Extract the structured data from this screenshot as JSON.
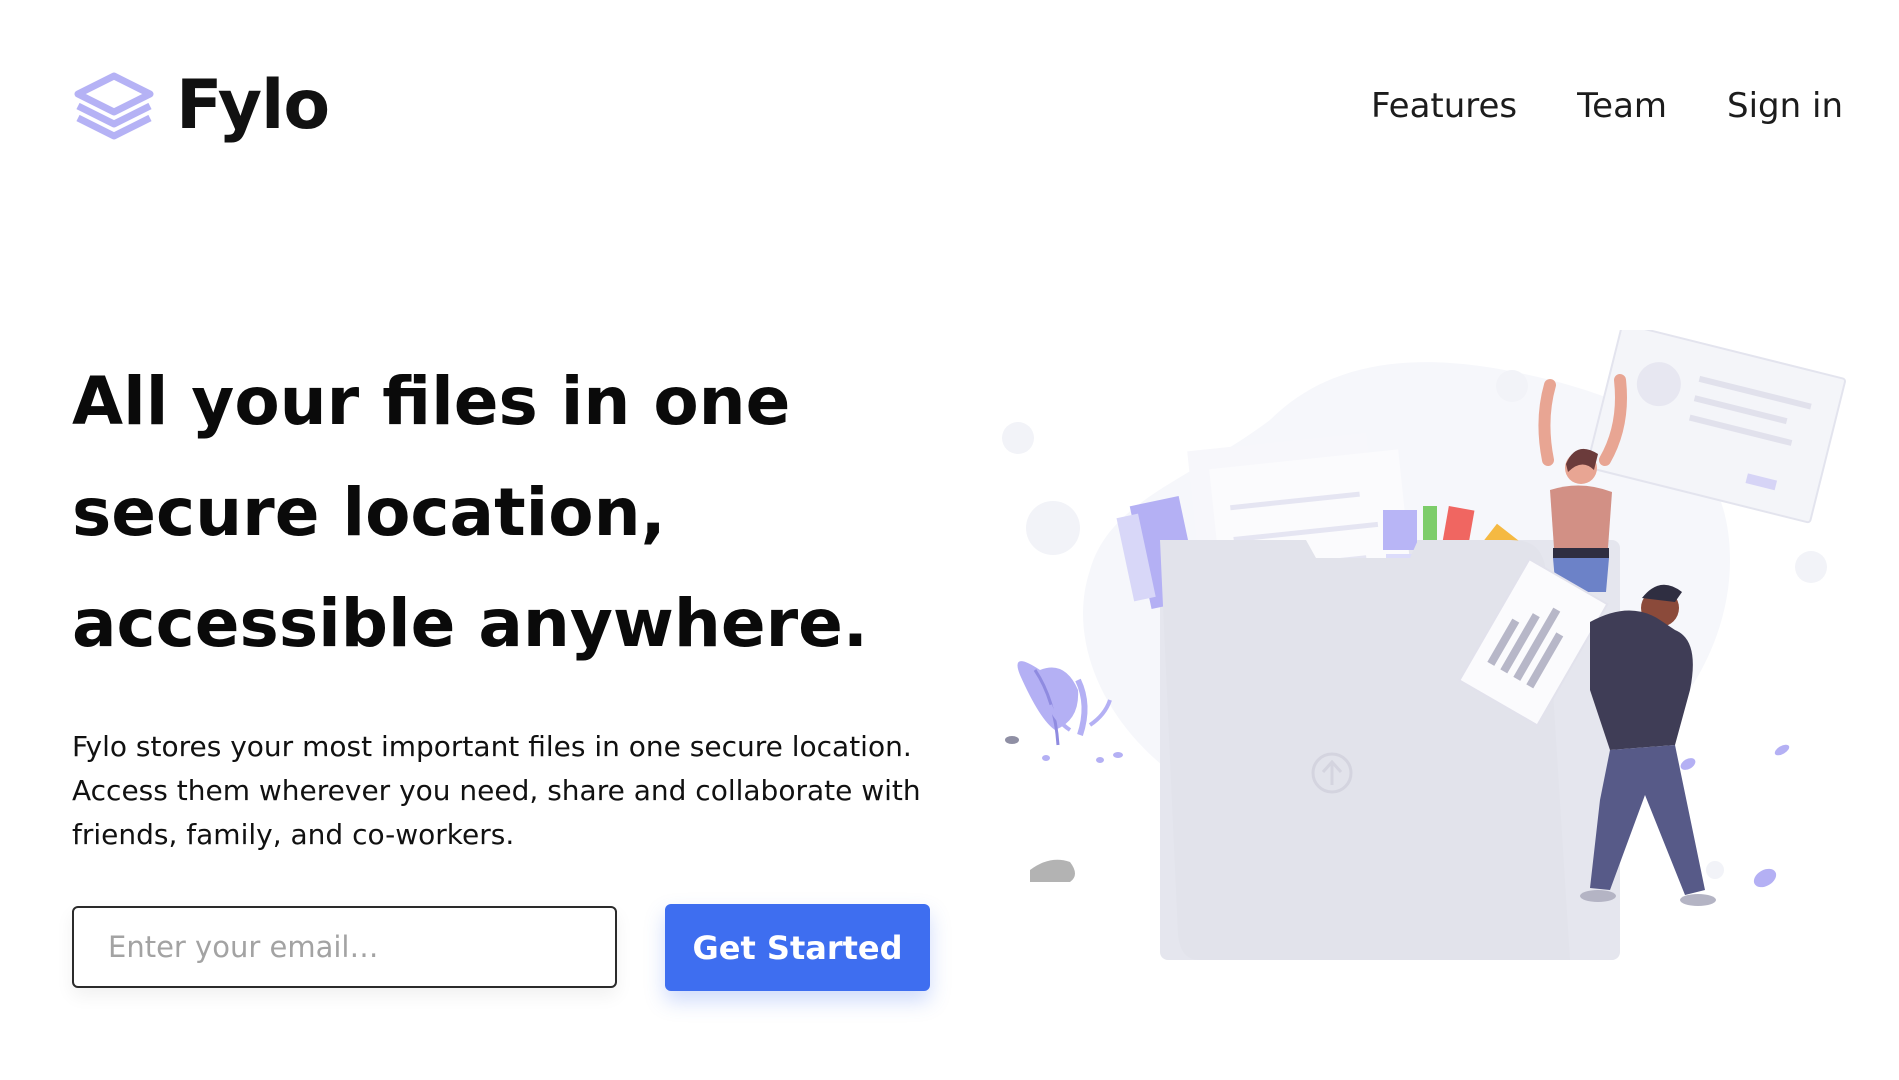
{
  "header": {
    "brand_name": "Fylo",
    "nav": [
      {
        "label": "Features"
      },
      {
        "label": "Team"
      },
      {
        "label": "Sign in"
      }
    ]
  },
  "hero": {
    "title_lines": [
      "All your files in one",
      "secure location,",
      "accessible anywhere."
    ],
    "description_lines": [
      "Fylo stores your most important files in one secure location.",
      "Access them wherever you need, share and collaborate with",
      "friends, family, and co-workers."
    ]
  },
  "form": {
    "email_placeholder": "Enter your email…",
    "cta_label": "Get Started"
  },
  "colors": {
    "brand_accent": "#3e6ef0",
    "logo_purple": "#b5b2f5",
    "illustration_purple": "#b4b0f4"
  },
  "icons": {
    "logo": "stacked-layers-icon",
    "upload": "upload-arrow-icon"
  }
}
